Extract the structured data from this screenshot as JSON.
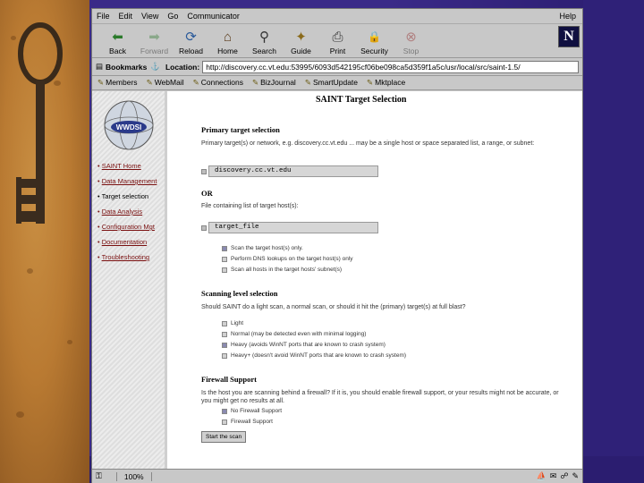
{
  "menu": [
    "File",
    "Edit",
    "View",
    "Go",
    "Communicator"
  ],
  "menu_help": "Help",
  "toolbar": [
    {
      "label": "Back",
      "icon": "back-arrow-icon",
      "glyph": "⬅",
      "enabled": true
    },
    {
      "label": "Forward",
      "icon": "forward-arrow-icon",
      "glyph": "➡",
      "enabled": false
    },
    {
      "label": "Reload",
      "icon": "reload-icon",
      "glyph": "⟳",
      "enabled": true
    },
    {
      "label": "Home",
      "icon": "home-icon",
      "glyph": "⌂",
      "enabled": true
    },
    {
      "label": "Search",
      "icon": "search-icon",
      "glyph": "⚲",
      "enabled": true
    },
    {
      "label": "Guide",
      "icon": "guide-icon",
      "glyph": "✦",
      "enabled": true
    },
    {
      "label": "Print",
      "icon": "print-icon",
      "glyph": "⎙",
      "enabled": true
    },
    {
      "label": "Security",
      "icon": "security-lock-icon",
      "glyph": "🔒",
      "enabled": true
    },
    {
      "label": "Stop",
      "icon": "stop-icon",
      "glyph": "⊗",
      "enabled": false
    }
  ],
  "logo_letter": "N",
  "location": {
    "bookmarks_label": "Bookmarks",
    "location_label": "Location:",
    "url": "http://discovery.cc.vt.edu:53995/6093d542195cf06be098ca5d359f1a5c/usr/local/src/saint-1.5/"
  },
  "personal_bar": [
    "Members",
    "WebMail",
    "Connections",
    "BizJournal",
    "SmartUpdate",
    "Mktplace"
  ],
  "side_nav": {
    "logo_text": "WWDSI",
    "links": [
      "SAINT Home",
      "Data Management",
      "Target selection",
      "Data Analysis",
      "Configuration Mgt",
      "Documentation",
      "Troubleshooting"
    ]
  },
  "page": {
    "title": "SAINT Target Selection",
    "primary_title": "Primary target selection",
    "primary_text": "Primary target(s) or network, e.g. discovery.cc.vt.edu ... may be a single host or space separated list, a range, or subnet:",
    "target_value": "discovery.cc.vt.edu",
    "or_label": "OR",
    "file_text": "File containing list of target host(s):",
    "file_value": "target_file",
    "scope_options": [
      "Scan the target host(s) only.",
      "Perform DNS lookups on the target host(s) only",
      "Scan all hosts in the target hosts' subnet(s)"
    ],
    "scan_title": "Scanning level selection",
    "scan_text": "Should SAINT do a light scan, a normal scan, or should it hit the (primary) target(s) at full blast?",
    "scan_options": [
      "Light",
      "Normal (may be detected even with minimal logging)",
      "Heavy (avoids WinNT ports that are known to crash system)",
      "Heavy+ (doesn't avoid WinNT ports that are known to crash system)"
    ],
    "firewall_title": "Firewall Support",
    "firewall_text": "Is the host you are scanning behind a firewall? If it is, you should enable firewall support, or your results might not be accurate, or you might get no results at all.",
    "firewall_options": [
      "No Firewall Support",
      "Firewall Support"
    ],
    "submit_label": "Start the scan"
  },
  "status": {
    "percent": "100%"
  }
}
